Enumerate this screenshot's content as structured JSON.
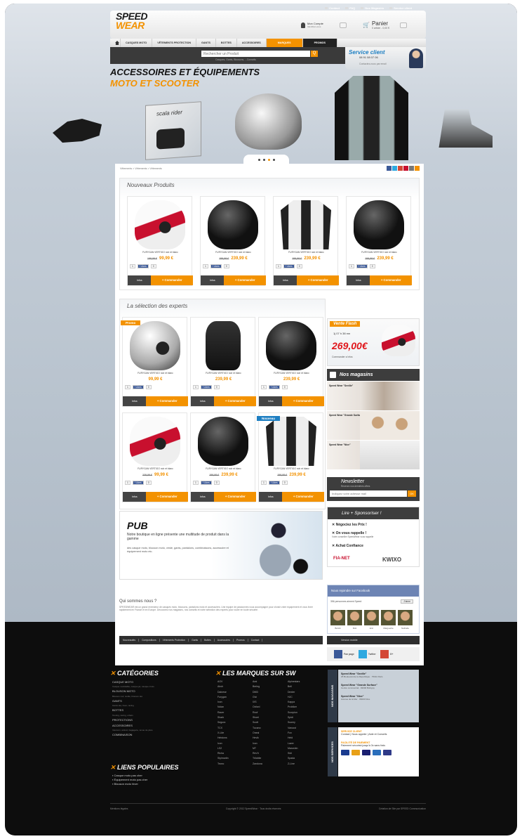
{
  "toplinks": [
    "Contact",
    "FAQ",
    "Nos Magasins",
    "Service client"
  ],
  "header": {
    "logo_line1": "SPEED",
    "logo_line2": "WEAR",
    "account_label": "Mon Compte",
    "account_sub": "Identifiez-vous",
    "cart_label": "Panier",
    "cart_sub": "0 article - 0,00 €"
  },
  "nav": {
    "items": [
      "CASQUES MOTO",
      "VÊTEMENTS PROTECTION",
      "GANTS",
      "BOTTES",
      "ACCESSOIRES",
      "MARQUES",
      "PROMOS"
    ]
  },
  "search": {
    "placeholder": "Rechercher un Produit",
    "sub": "Casques, Gants, Blousons, ...Conseils",
    "button": "Q"
  },
  "service": {
    "title": "Service client",
    "phone": "08 91 08 07 06",
    "sub": "Contactez-nous par email"
  },
  "banner": {
    "line1": "ACCESSOIRES ET ÉQUIPEMENTS",
    "line2": "MOTO ET SCOOTER",
    "scala_label": "scala rider"
  },
  "breadcrumb": "Vêtements > Vêtements > Vêtements",
  "colors": {
    "accent": "#f39200",
    "dark": "#3d3d3d",
    "price_red": "#e0161b",
    "link_blue": "#1e7fc2"
  },
  "new_products": {
    "title": "Nouveaux Produits",
    "items": [
      {
        "name": "FURYGAN VERTIGO noir et blanc",
        "old": "199,99 €",
        "price": "99,99 €",
        "icon": "helmet-red"
      },
      {
        "name": "FURYGAN VERTIGO noir et blanc",
        "old": "299,99 €",
        "price": "239,99 €",
        "icon": "helmet-black"
      },
      {
        "name": "FURYGAN VERTIGO noir et blanc",
        "old": "299,99 €",
        "price": "239,99 €",
        "icon": "jacket"
      },
      {
        "name": "FURYGAN VERTIGO noir et blanc",
        "old": "299,99 €",
        "price": "239,99 €",
        "icon": "helmet-black"
      }
    ]
  },
  "card_common": {
    "qty": "1",
    "fb": "f Likes",
    "count": "0",
    "info": "Infos",
    "order": "+ Commander"
  },
  "experts": {
    "title": "La sélection des experts",
    "items": [
      {
        "name": "FURYGAN VERTIGO noir et blanc",
        "old": "",
        "price": "99,99 €",
        "badge": "Promo",
        "icon": "helmet-white"
      },
      {
        "name": "FURYGAN VERTIGO noir et blanc",
        "old": "",
        "price": "239,99 €",
        "badge": "",
        "icon": "bag"
      },
      {
        "name": "FURYGAN VERTIGO noir et blanc",
        "old": "",
        "price": "239,99 €",
        "badge": "",
        "icon": "helmet-black"
      },
      {
        "name": "FURYGAN VERTIGO noir et blanc",
        "old": "239,99 €",
        "price": "99,99 €",
        "badge": "",
        "icon": "helmet-red"
      },
      {
        "name": "FURYGAN VERTIGO noir et blanc",
        "old": "299,99 €",
        "price": "239,99 €",
        "badge": "",
        "icon": "helmet-black"
      },
      {
        "name": "FURYGAN VERTIGO noir et blanc",
        "old": "299,99 €",
        "price": "239,99 €",
        "badge": "Nouveau",
        "icon": "jacket"
      }
    ]
  },
  "flash": {
    "title": "Vente Flash",
    "time": "1j 07 h 38 mn",
    "price": "269,00€",
    "actions": "Commander  ♦ Infos"
  },
  "stores": {
    "title": "Nos magasins",
    "items": [
      "Speed Wear \"Seville\"",
      "Speed Wear \"Grande Surface\"",
      "Speed Wear \"Nice\""
    ]
  },
  "newsletter": {
    "title": "Newsletter",
    "sub": "Recevez nos dernières offres",
    "placeholder": "Indiquez votre adresse mail",
    "button": "OK"
  },
  "sponsor": {
    "title": "Lire + Sponsoriser !",
    "rows": [
      {
        "label": "Négociez les Prix !",
        "sub": ""
      },
      {
        "label": "On vous rappelle !",
        "sub": "Votre conseiller SpeedWear vous rappelle"
      },
      {
        "label": "Achat Confiance",
        "sub": ""
      }
    ],
    "fianet": "FIA-NET",
    "kwixo": "KWIXO"
  },
  "facebook": {
    "title": "Nous rejoindre sur Facebook",
    "likes": "356 personnes aiment Speed",
    "like_btn": "J'aime",
    "names": [
      "Bérick",
      "Rob",
      "Eric",
      "Marguerite",
      "Nathalie"
    ]
  },
  "pub": {
    "title": "PUB",
    "line": "Notre boutique en ligne présente une multitude de produit dans la gamme",
    "sub": "des casque moto, blouson moto, veste, gants, pantalons, combinaisons, accessoire et équipement moto etc."
  },
  "about": {
    "title": "Qui sommes nous ?",
    "text": "SPEEDWEAR est un grand revendeur de casques moto, blousons, pantalons moto et accessoires. Une équipe de passionnés vous accompagne pour choisir votre équipement et vous livrer rapidement en France et en Europe. Découvrez nos magasins, nos conseils et notre sélection des experts pour rouler en toute sécurité."
  },
  "footnav": [
    "Nouveautés",
    "Compositions",
    "Vêtements Protection",
    "Gants",
    "Bottes",
    "Accessoires",
    "Promos",
    "Contact"
  ],
  "mobile": "Version mobile",
  "social": [
    {
      "label": "Fan page",
      "color": "#3b5998"
    },
    {
      "label": "Twitter",
      "color": "#2fa9e0"
    },
    {
      "label": "G+",
      "color": "#d34836"
    }
  ],
  "footer": {
    "categories_title": "CATÉGORIES",
    "categories": [
      {
        "name": "CASQUE MOTO",
        "sub": "Casque modulable, casque jet, casque cross"
      },
      {
        "name": "BLOUSON MOTO",
        "sub": "Blouson cuir, textile, blouson été"
      },
      {
        "name": "GANTS",
        "sub": "Gants été, hiver, racing"
      },
      {
        "name": "BOTTES",
        "sub": "Touring, racing, urbain"
      },
      {
        "name": "PROTECTIONS",
        "sub": ""
      },
      {
        "name": "ACCESSOIRES",
        "sub": "Intercom, antivol, bagagerie, tenue de pluie"
      },
      {
        "name": "COMBINAISON",
        "sub": ""
      }
    ],
    "popular_title": "LIENS POPULAIRES",
    "popular": [
      "Casque moto pas cher",
      "Équipement moto pas cher",
      "Blouson moto hiver"
    ],
    "brands_title": "LES MARQUES SUR SW",
    "brands": [
      "AGV",
      "Arai",
      "Alpinestars",
      "Airoh",
      "Bering",
      "Bell",
      "Dainese",
      "DMD",
      "Dexter",
      "Furygan",
      "Givi",
      "HJC",
      "Ixon",
      "IXS",
      "Kappa",
      "Nolan",
      "Oxford",
      "Probiker",
      "Racer",
      "Roof",
      "Scorpion",
      "Shark",
      "Shoei",
      "Spidi",
      "Segura",
      "Scott",
      "Suomy",
      "TCX",
      "Tucano",
      "Vanucci",
      "X-Lite",
      "Oneal",
      "Fox",
      "Helstons",
      "Hevik",
      "Held",
      "Icon",
      "Ixon",
      "Lazer",
      "LS2",
      "MT",
      "Marushin",
      "Richa",
      "Rev'it",
      "Sidi",
      "Stylmartin",
      "Trilobite",
      "Spada",
      "Tecno",
      "Zandona",
      "Z-Line"
    ],
    "stores_tab": "NOS MAGASINS",
    "stores": [
      {
        "name": "Speed Wear \"Seville\"",
        "addr": "25 Boulevard de la République · 75011 Paris"
      },
      {
        "name": "Speed Wear \"Grande Surface\"",
        "addr": "Centre commercial · 93000 Bobigny"
      },
      {
        "name": "Speed Wear \"Nice\"",
        "addr": "Avenue de la Mer · 06000 Nice"
      }
    ],
    "services_tab": "NOS SERVICES",
    "services_title": "SERVICE CLIENT",
    "services_links": "Contact | Nous appeler | Aide et Conseils",
    "payment_title": "FACILITÉ DE PAIEMENT",
    "payment_sub": "Paiement sécurisé jusqu'à 3x sans frais",
    "bottom_left": "Mentions légales",
    "bottom_center": "Copyright © 2012 SpeedWear · Tous droits réservés",
    "bottom_right": "Création de Site par SPEED Communication"
  }
}
